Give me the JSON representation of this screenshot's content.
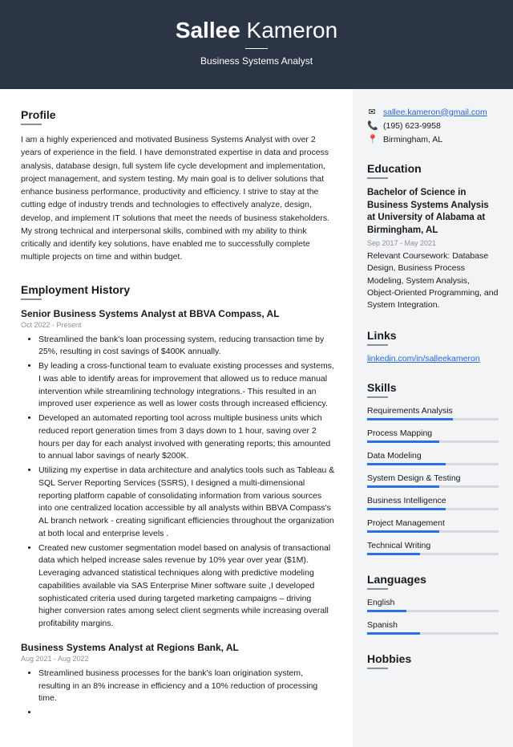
{
  "header": {
    "first_name": "Sallee",
    "last_name": "Kameron",
    "title": "Business Systems Analyst"
  },
  "profile": {
    "heading": "Profile",
    "text": "I am a highly experienced and motivated Business Systems Analyst with over 2 years of experience in the field. I have demonstrated expertise in data and process analysis, database design, full system life cycle development and implementation, project management, and system testing. My main goal is to deliver solutions that enhance business performance, productivity and efficiency. I strive to stay at the cutting edge of industry trends and technologies to effectively analyze, design, develop, and implement IT solutions that meet the needs of business stakeholders. My strong technical and interpersonal skills, combined with my ability to think critically and identify key solutions, have enabled me to successfully complete multiple projects on time and within budget."
  },
  "employment": {
    "heading": "Employment History",
    "jobs": [
      {
        "title": "Senior Business Systems Analyst at BBVA Compass, AL",
        "dates": "Oct 2022 - Present",
        "bullets": [
          "Streamlined the bank's loan processing system, reducing transaction time by 25%, resulting in cost savings of $400K annually.",
          "By leading a cross-functional team to evaluate existing processes and systems, I was able to identify areas for improvement that allowed us to reduce manual intervention while streamlining technology integrations.- This resulted in an improved user experience as well as lower costs through increased efficiency.",
          "Developed an automated reporting tool across multiple business units which reduced report generation times from 3 days down to 1 hour, saving over 2 hours per day for each analyst involved with generating reports; this amounted to annual labor savings of nearly $200K.",
          "Utilizing my expertise in data architecture and analytics tools such as Tableau & SQL Server Reporting Services (SSRS), I designed a multi-dimensional reporting platform capable of consolidating information from various sources into one centralized location accessible by all analysts within BBVA Compass's AL branch network - creating significant efficiencies throughout the organization at both local and enterprise levels .",
          "Created new customer segmentation model based on analysis of transactional data which helped increase sales revenue by 10% year over year ($1M).  Leveraging advanced statistical techniques along with predictive modeling capabilities available via SAS Enterprise Miner software suite ,I developed sophisticated criteria used during targeted marketing campaigns – driving higher conversion rates among select client segments while increasing overall profitability margins."
        ]
      },
      {
        "title": "Business Systems Analyst at Regions Bank, AL",
        "dates": "Aug 2021 - Aug 2022",
        "bullets": [
          "Streamlined business processes for the bank's loan origination system, resulting in an 8% increase in efficiency and a 10% reduction of processing time.",
          ""
        ]
      }
    ]
  },
  "contact": {
    "email": "sallee.kameron@gmail.com",
    "phone": "(195) 623-9958",
    "location": "Birmingham, AL"
  },
  "education": {
    "heading": "Education",
    "degree": "Bachelor of Science in Business Systems Analysis at University of Alabama at Birmingham, AL",
    "dates": "Sep 2017 - May 2021",
    "text": "Relevant Coursework: Database Design, Business Process Modeling, System Analysis, Object-Oriented Programming, and System Integration."
  },
  "links": {
    "heading": "Links",
    "url": "linkedin.com/in/salleekameron"
  },
  "skills": {
    "heading": "Skills",
    "items": [
      {
        "name": "Requirements Analysis",
        "level": 65
      },
      {
        "name": "Process Mapping",
        "level": 55
      },
      {
        "name": "Data Modeling",
        "level": 60
      },
      {
        "name": "System Design & Testing",
        "level": 55
      },
      {
        "name": "Business Intelligence",
        "level": 60
      },
      {
        "name": "Project Management",
        "level": 55
      },
      {
        "name": "Technical Writing",
        "level": 40
      }
    ]
  },
  "languages": {
    "heading": "Languages",
    "items": [
      {
        "name": "English",
        "level": 30
      },
      {
        "name": "Spanish",
        "level": 40
      }
    ]
  },
  "hobbies": {
    "heading": "Hobbies"
  }
}
